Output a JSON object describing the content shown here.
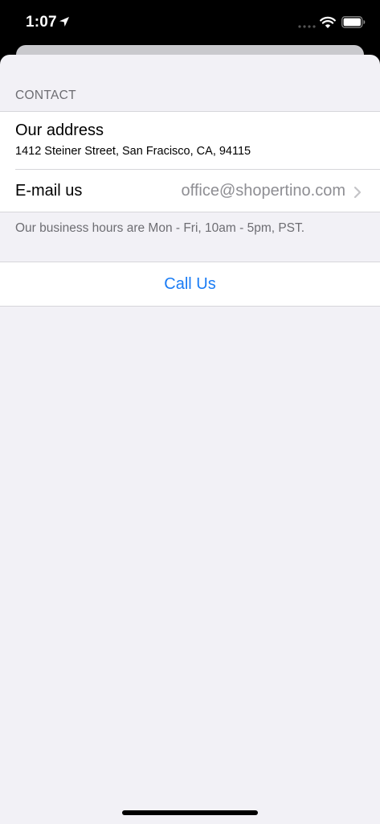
{
  "status_bar": {
    "time": "1:07"
  },
  "contact": {
    "section_header": "CONTACT",
    "address_label": "Our address",
    "address_value": "1412 Steiner Street, San Fracisco, CA, 94115",
    "email_label": "E-mail us",
    "email_value": "office@shopertino.com",
    "hours_note": "Our business hours are Mon - Fri, 10am - 5pm, PST."
  },
  "call_button_label": "Call Us",
  "colors": {
    "accent": "#1a7cf5",
    "background": "#f2f1f6",
    "secondary_text": "#6d6d72"
  },
  "icons": [
    "location-arrow-icon",
    "cellular-signal-icon",
    "wifi-icon",
    "battery-icon",
    "chevron-right-icon"
  ]
}
